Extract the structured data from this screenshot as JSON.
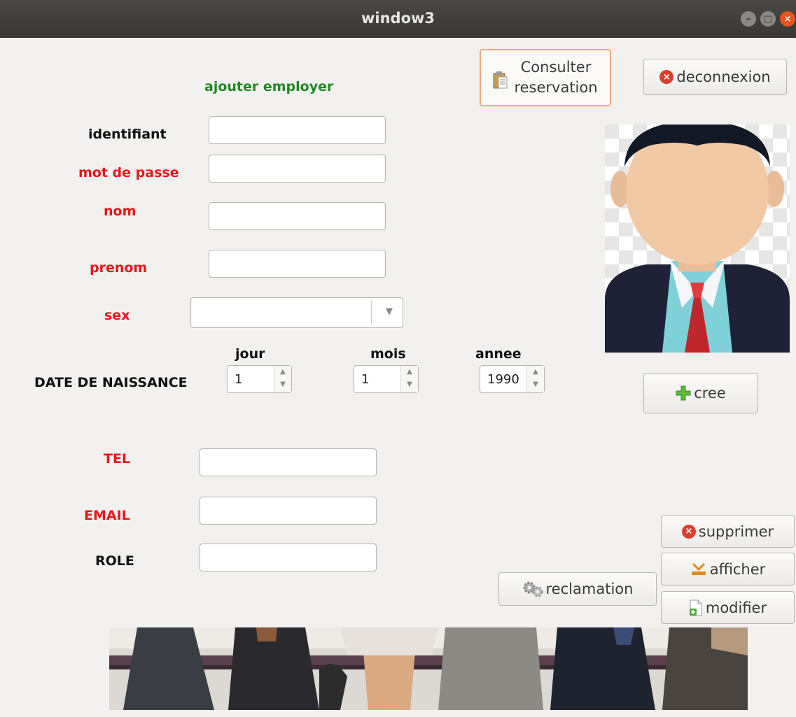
{
  "window": {
    "title": "window3"
  },
  "form": {
    "heading": "ajouter employer",
    "labels": {
      "identifiant": "identifiant",
      "mot_de_passe": "mot de passe",
      "nom": "nom",
      "prenom": "prenom",
      "sex": "sex",
      "date_naissance": "DATE DE NAISSANCE",
      "jour": "jour",
      "mois": "mois",
      "annee": "annee",
      "tel": "TEL",
      "email": "EMAIL",
      "role": "ROLE"
    },
    "values": {
      "identifiant": "",
      "mot_de_passe": "",
      "nom": "",
      "prenom": "",
      "sex": "",
      "jour": "1",
      "mois": "1",
      "annee": "1990",
      "tel": "",
      "email": "",
      "role": ""
    }
  },
  "buttons": {
    "consulter_line1": "Consulter",
    "consulter_line2": "reservation",
    "deconnexion": "deconnexion",
    "cree": "cree",
    "supprimer": "supprimer",
    "afficher": "afficher",
    "modifier": "modifier",
    "reclamation": "reclamation"
  },
  "icons": {
    "consulter": "clipboard-icon",
    "deconnexion": "close-circle-icon",
    "cree": "plus-icon",
    "supprimer": "close-circle-icon",
    "afficher": "display-icon",
    "modifier": "document-add-icon",
    "reclamation": "gears-icon"
  },
  "colors": {
    "label_red": "#e8161a",
    "label_green": "#1f8a1f",
    "label_black": "#111111",
    "titlebar": "#3a3835",
    "window_bg": "#f2f1f0"
  }
}
